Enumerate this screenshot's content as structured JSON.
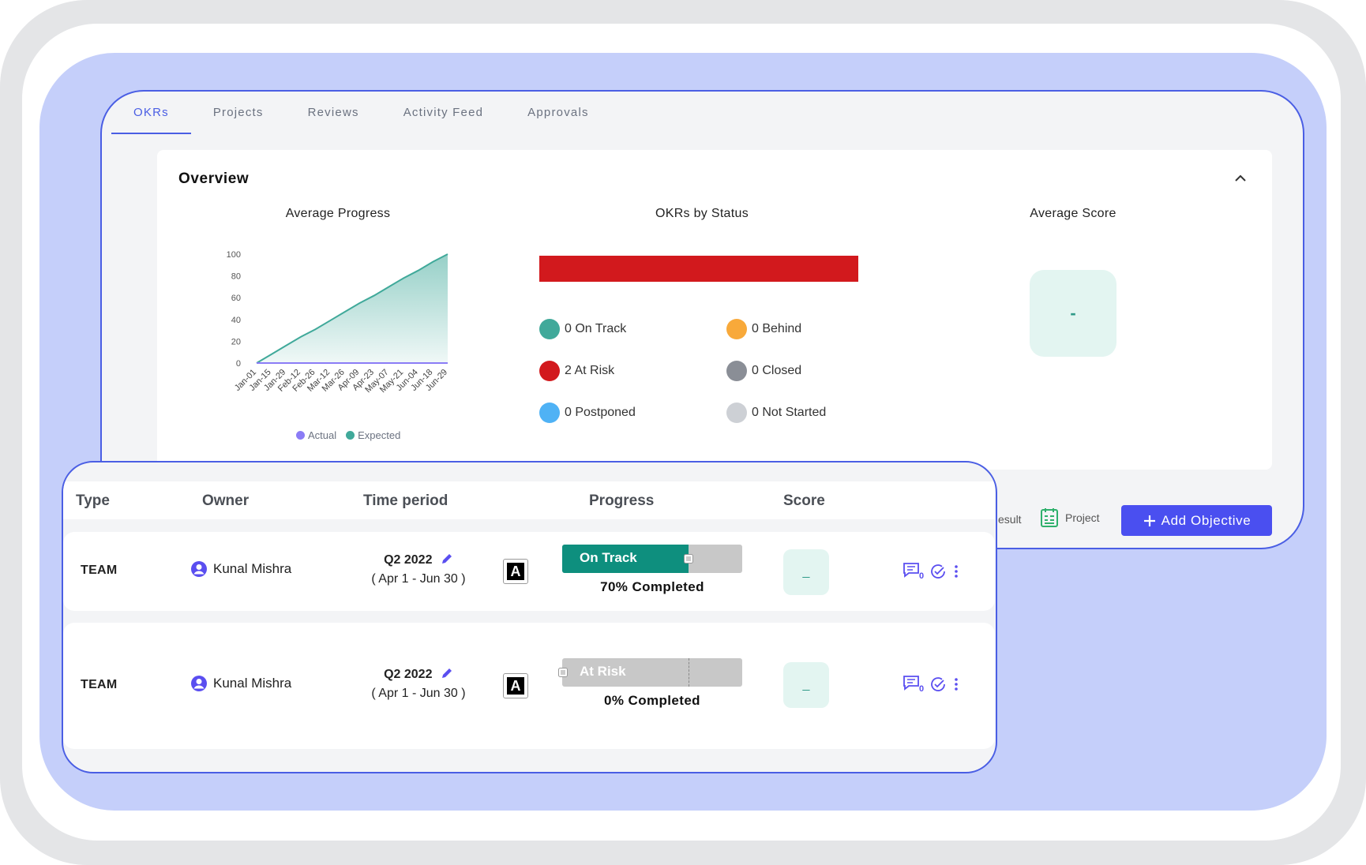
{
  "tabs": [
    {
      "label": "OKRs",
      "active": true
    },
    {
      "label": "Projects",
      "active": false
    },
    {
      "label": "Reviews",
      "active": false
    },
    {
      "label": "Activity Feed",
      "active": false
    },
    {
      "label": "Approvals",
      "active": false
    }
  ],
  "overview": {
    "title": "Overview",
    "average_progress_title": "Average Progress",
    "okrs_by_status_title": "OKRs by Status",
    "average_score_title": "Average Score",
    "average_score_value": "-",
    "legend": {
      "actual": "Actual",
      "expected": "Expected"
    },
    "status": [
      {
        "label": "0 On Track",
        "color": "#40a99a"
      },
      {
        "label": "0 Behind",
        "color": "#f8a93a"
      },
      {
        "label": "2 At Risk",
        "color": "#d2191d"
      },
      {
        "label": "0 Closed",
        "color": "#8a8e96"
      },
      {
        "label": "0 Postponed",
        "color": "#4fb2f5"
      },
      {
        "label": "0 Not Started",
        "color": "#cdd0d5"
      }
    ],
    "status_bar_color": "#d2191d"
  },
  "chart_data": {
    "type": "area",
    "title": "Average Progress",
    "x": [
      "Jan-01",
      "Jan-15",
      "Jan-29",
      "Feb-12",
      "Feb-26",
      "Mar-12",
      "Mar-26",
      "Apr-09",
      "Apr-23",
      "May-07",
      "May-21",
      "Jun-04",
      "Jun-18",
      "Jun-29"
    ],
    "yticks": [
      0,
      20,
      40,
      60,
      80,
      100
    ],
    "ylim": [
      0,
      100
    ],
    "series": [
      {
        "name": "Expected",
        "values": [
          0,
          8,
          16,
          24,
          31,
          39,
          47,
          55,
          62,
          70,
          78,
          85,
          93,
          100
        ],
        "color": "#40a99a"
      },
      {
        "name": "Actual",
        "values": [
          0,
          0,
          0,
          0,
          0,
          0,
          0,
          0,
          0,
          0,
          0,
          0,
          0,
          0
        ],
        "color": "#8b7cf6"
      }
    ]
  },
  "actions": {
    "result_partial": "esult",
    "project_label": "Project",
    "add_objective": "Add Objective"
  },
  "table": {
    "headers": [
      "Type",
      "Owner",
      "Time period",
      "Progress",
      "Score"
    ],
    "rows": [
      {
        "type": "TEAM",
        "owner": "Kunal Mishra",
        "quarter": "Q2 2022",
        "range": "( Apr 1 - Jun 30 )",
        "badge": "A",
        "status": "On Track",
        "progress": 70,
        "completed": "70% Completed",
        "score": "_",
        "comments": "0"
      },
      {
        "type": "TEAM",
        "owner": "Kunal Mishra",
        "quarter": "Q2 2022",
        "range": "( Apr 1 - Jun 30 )",
        "badge": "A",
        "status": "At Risk",
        "progress": 0,
        "completed": "0% Completed",
        "score": "_",
        "comments": "0"
      }
    ]
  }
}
